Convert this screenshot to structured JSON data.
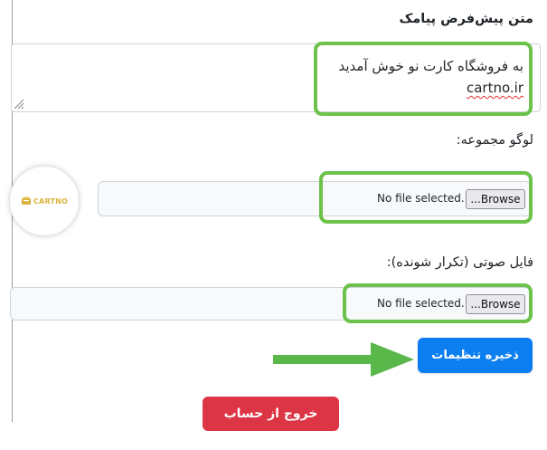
{
  "sms_section": {
    "label": "متن پیش‌فرض پیامک",
    "text_line1": "به فروشگاه کارت نو خوش آمدید",
    "text_line2": "cartno.ir"
  },
  "logo_section": {
    "label": "لوگو مجموعه:",
    "logo_brand_text": "CARTNO",
    "file_status": "No file selected.",
    "browse_label": "Browse..."
  },
  "audio_section": {
    "label": "فایل صوتی (تکرار شونده):",
    "file_status": "No file selected.",
    "browse_label": "Browse..."
  },
  "actions": {
    "save_label": "ذخیره تنظیمات",
    "logout_label": "خروج از حساب"
  },
  "colors": {
    "highlight": "#6cc24a",
    "primary": "#0d7ef0",
    "danger": "#dc3545",
    "logo_gold": "#d9b23a"
  }
}
